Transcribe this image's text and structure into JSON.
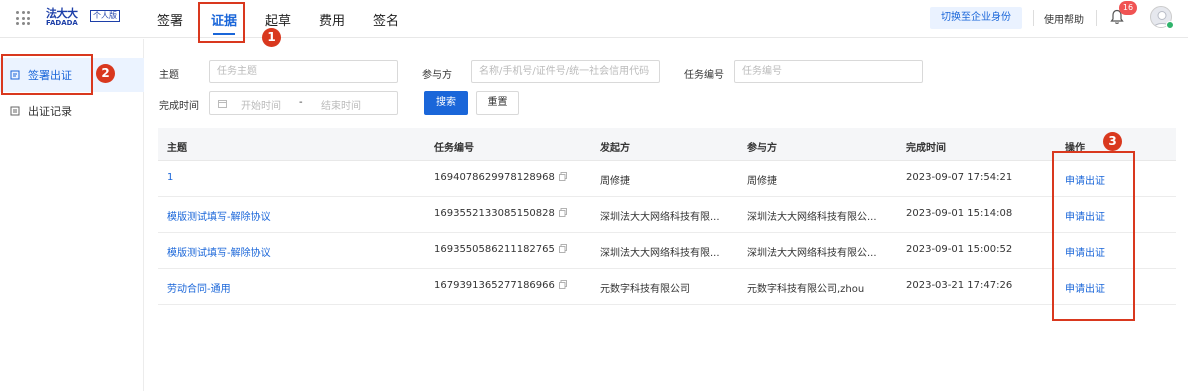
{
  "header": {
    "logo_cn": "法大大",
    "logo_en": "FADADA",
    "logo_tag": "个人版",
    "nav": [
      "签署",
      "证据",
      "起草",
      "费用",
      "签名"
    ],
    "active_nav": "证据",
    "switch_label": "切换至企业身份",
    "help_label": "使用帮助",
    "notification_count": "16"
  },
  "sidebar": {
    "items": [
      {
        "label": "签署出证",
        "icon": "document-icon",
        "active": true
      },
      {
        "label": "出证记录",
        "icon": "record-icon",
        "active": false
      }
    ]
  },
  "filters": {
    "subject_label": "主题",
    "subject_placeholder": "任务主题",
    "party_label": "参与方",
    "party_placeholder": "名称/手机号/证件号/统一社会信用代码",
    "task_no_label": "任务编号",
    "task_no_placeholder": "任务编号",
    "done_time_label": "完成时间",
    "start_placeholder": "开始时间",
    "range_sep": "-",
    "end_placeholder": "结束时间",
    "search_label": "搜索",
    "reset_label": "重置"
  },
  "table": {
    "columns": [
      "主题",
      "任务编号",
      "发起方",
      "参与方",
      "完成时间",
      "操作"
    ],
    "rows": [
      {
        "subject": "1",
        "task_no": "1694078629978128968",
        "initiator": "周修捷",
        "participant": "周修捷",
        "done_time": "2023-09-07 17:54:21",
        "action": "申请出证"
      },
      {
        "subject": "模版测试填写-解除协议",
        "task_no": "1693552133085150828",
        "initiator": "深圳法大大网络科技有限...",
        "participant": "深圳法大大网络科技有限公...",
        "done_time": "2023-09-01 15:14:08",
        "action": "申请出证"
      },
      {
        "subject": "模版测试填写-解除协议",
        "task_no": "1693550586211182765",
        "initiator": "深圳法大大网络科技有限...",
        "participant": "深圳法大大网络科技有限公...",
        "done_time": "2023-09-01 15:00:52",
        "action": "申请出证"
      },
      {
        "subject": "劳动合同-通用",
        "task_no": "1679391365277186966",
        "initiator": "元数字科技有限公司",
        "participant": "元数字科技有限公司,zhou",
        "done_time": "2023-03-21 17:47:26",
        "action": "申请出证"
      }
    ]
  },
  "annotations": {
    "step1": "1",
    "step2": "2",
    "step3": "3",
    "color": "#d9381e"
  },
  "colors": {
    "accent": "#1a66d9",
    "badge": "#f05353",
    "sidebar_active_bg": "#ebf3ff"
  }
}
